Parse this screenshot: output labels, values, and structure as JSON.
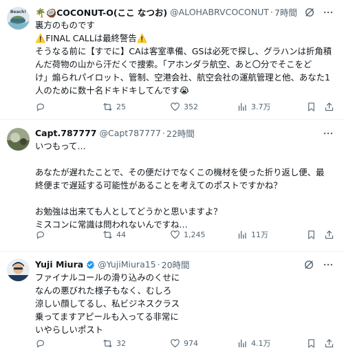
{
  "tweets": [
    {
      "author": {
        "name": "🌴🥥COCONUT-O(ここ なつお)",
        "handle": "@ALOHABRVCOCONUT",
        "time": "7時間",
        "avatar_text": "Beach!",
        "verified": false
      },
      "lines": [
        "裏方のものです",
        "⚠️FINAL CALLは最終警告⚠️",
        "そうなる前に【すでに】CAは客室準備、GSは必死で探し、グラハンは折角積",
        "んだ荷物の山から汗だくで捜索。「アホンダラ航空、あと〇分でそこをど",
        "け」煽られパイロット、管制、空港会社、航空会社の運航管理と他、あなた1",
        "人のために数十名ドキドキしてんです😭"
      ],
      "stats": {
        "replies": "",
        "retweets": "25",
        "likes": "352",
        "views": "3.7万"
      }
    },
    {
      "author": {
        "name": "Capt.787777",
        "handle": "@Capt787777",
        "time": "22時間",
        "verified": false
      },
      "lines": [
        "いつもって…",
        "",
        "あなたが遅れたことで、その便だけでなくこの機材を使った折り返し便、最",
        "終便まで遅延する可能性があることを考えてのポストですかね？",
        "",
        "お勉強は出来ても人としてどうかと思いますよ？",
        "ミスコンに常識は問われないんですね…"
      ],
      "stats": {
        "replies": "",
        "retweets": "44",
        "likes": "1,245",
        "views": "11万"
      }
    },
    {
      "author": {
        "name": "Yuji Miura",
        "handle": "@YujiMiura15",
        "time": "20時間",
        "verified": true
      },
      "lines": [
        "ファイナルコールの滑り込みのくせに",
        "なんの悪びれた様子もなく、むしろ",
        "涼しい顔してるし、私ビジネスクラス",
        "乗ってますアピールも入ってる非常に",
        "いやらしいポスト"
      ],
      "stats": {
        "replies": "",
        "retweets": "32",
        "likes": "974",
        "views": "4.1万"
      }
    }
  ],
  "colors": {
    "text": "#0f1419",
    "muted": "#536471",
    "verified": "#1d9bf0",
    "divider": "#eff3f4"
  },
  "icons": [
    "grok-icon",
    "more-icon",
    "reply-icon",
    "retweet-icon",
    "like-icon",
    "views-icon",
    "bookmark-icon",
    "share-icon",
    "verified-badge-icon"
  ]
}
